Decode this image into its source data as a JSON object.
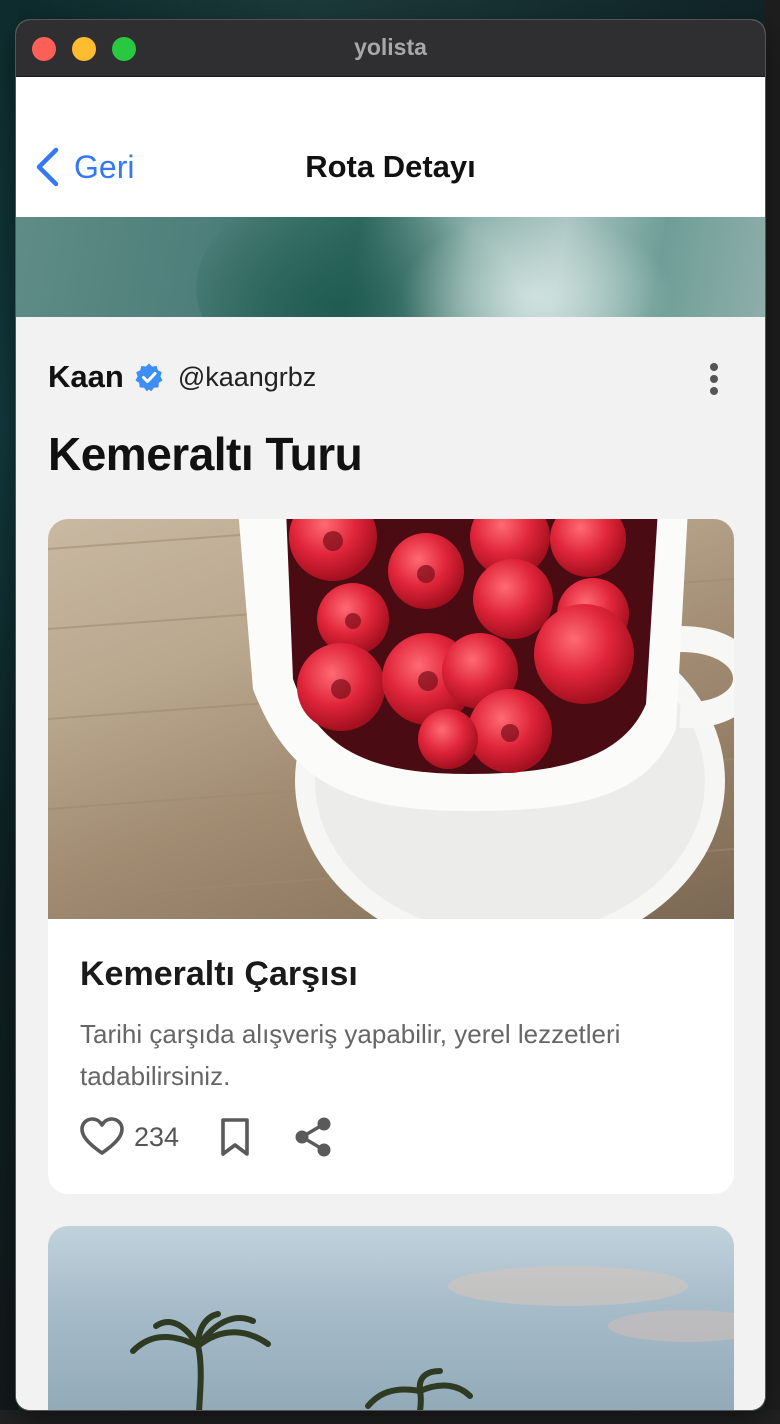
{
  "window": {
    "title": "yolista"
  },
  "nav": {
    "back_label": "Geri",
    "title": "Rota Detayı"
  },
  "author": {
    "name": "Kaan",
    "handle": "@kaangrbz",
    "verified": true
  },
  "route": {
    "title": "Kemeraltı Turu"
  },
  "stops": [
    {
      "title": "Kemeraltı Çarşısı",
      "description": "Tarihi çarşıda alışveriş yapabilir, yerel lezzetleri tadabilirsiniz.",
      "likes": "234"
    }
  ],
  "colors": {
    "accent": "#3478f6",
    "verified": "#3d8ef5",
    "background": "#f2f2f2"
  },
  "icons": [
    "chevron-left-icon",
    "verified-badge-icon",
    "more-vertical-icon",
    "heart-icon",
    "bookmark-icon",
    "share-icon"
  ]
}
